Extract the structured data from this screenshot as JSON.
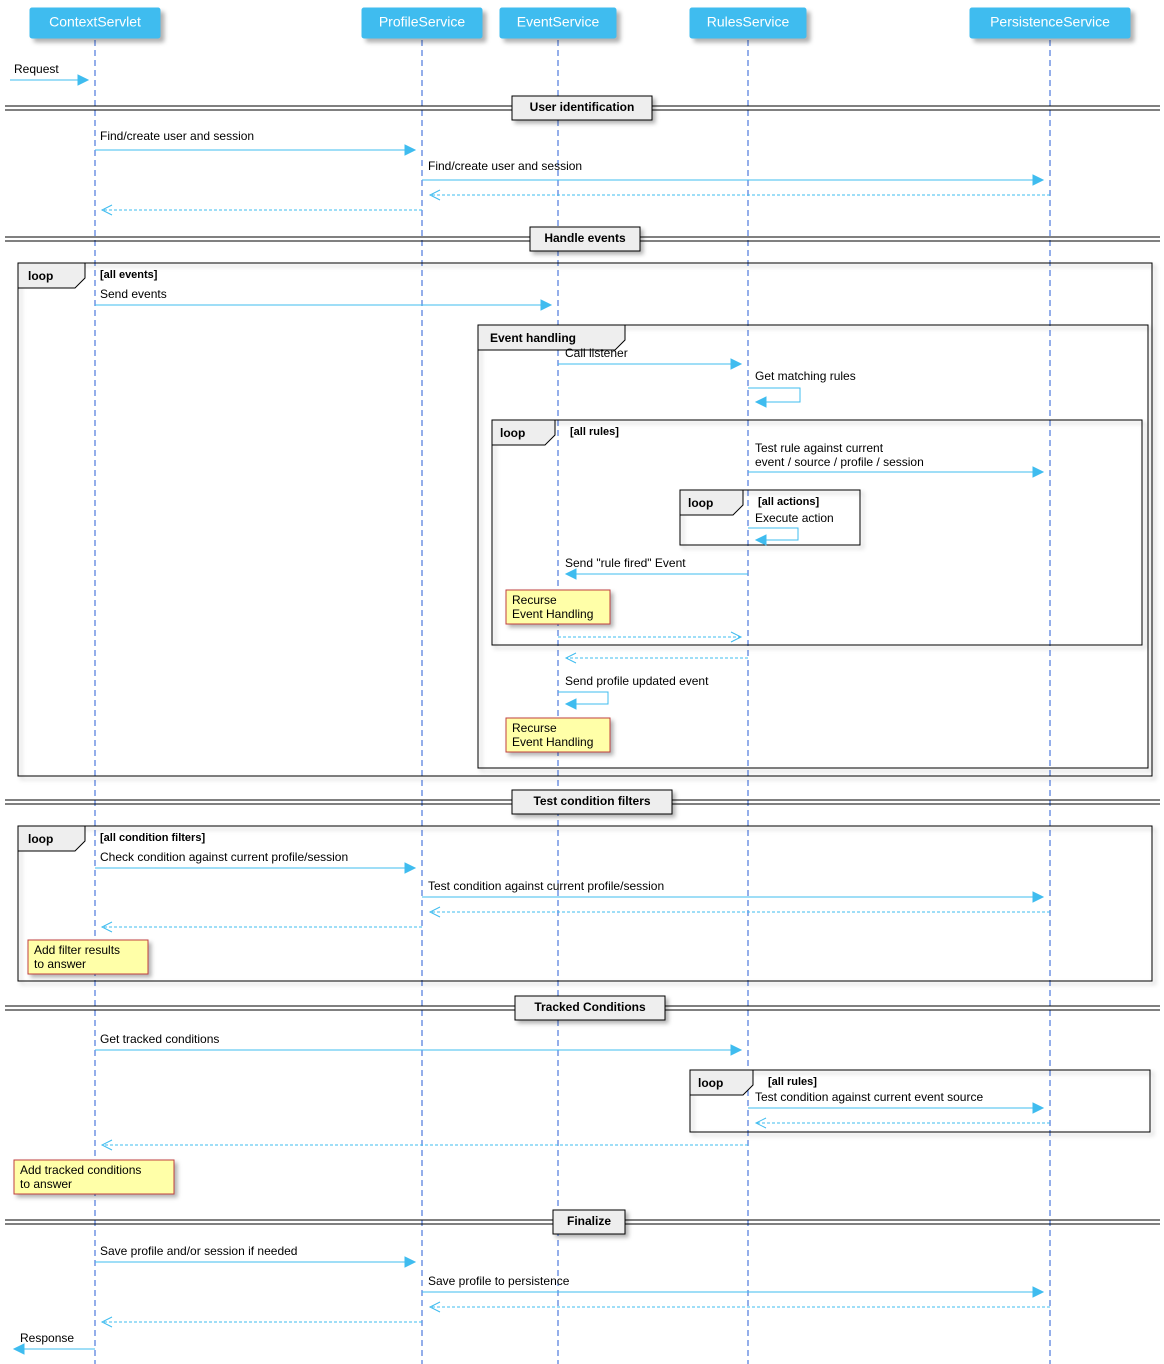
{
  "participants": {
    "p1": "ContextServlet",
    "p2": "ProfileService",
    "p3": "EventService",
    "p4": "RulesService",
    "p5": "PersistenceService"
  },
  "dividers": {
    "d1": "User identification",
    "d2": "Handle events",
    "d3": "Test condition filters",
    "d4": "Tracked Conditions",
    "d5": "Finalize"
  },
  "messages": {
    "m1": "Request",
    "m2": "Find/create user and session",
    "m3": "Find/create user and session",
    "m4": "Send events",
    "m5": "Call listener",
    "m6": "Get matching rules",
    "m7": "Test rule against current",
    "m7b": "event / source / profile / session",
    "m8": "Execute action",
    "m9": "Send \"rule fired\" Event",
    "m10": "Send profile updated event",
    "m11": "Check condition against current profile/session",
    "m12": "Test condition against current profile/session",
    "m13": "Get tracked conditions",
    "m14": "Test condition against current event source",
    "m15": "Save profile and/or session if needed",
    "m16": "Save profile to persistence",
    "m17": "Response"
  },
  "frames": {
    "loop1": {
      "label": "loop",
      "guard": "[all events]"
    },
    "ref1": {
      "label": "Event handling"
    },
    "loop2": {
      "label": "loop",
      "guard": "[all rules]"
    },
    "loop3": {
      "label": "loop",
      "guard": "[all actions]"
    },
    "loop4": {
      "label": "loop",
      "guard": "[all condition filters]"
    },
    "loop5": {
      "label": "loop",
      "guard": "[all rules]"
    }
  },
  "notes": {
    "n1a": "Recurse",
    "n1b": "Event Handling",
    "n2a": "Recurse",
    "n2b": "Event Handling",
    "n3a": "Add filter results",
    "n3b": " to answer",
    "n4a": "Add tracked conditions",
    "n4b": "to answer"
  }
}
